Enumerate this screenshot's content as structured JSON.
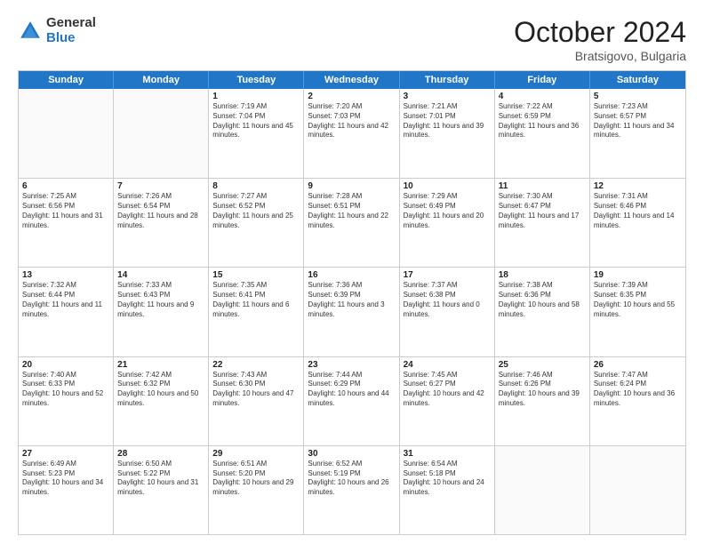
{
  "header": {
    "logo": {
      "general": "General",
      "blue": "Blue"
    },
    "month": "October 2024",
    "location": "Bratsigovo, Bulgaria"
  },
  "weekdays": [
    "Sunday",
    "Monday",
    "Tuesday",
    "Wednesday",
    "Thursday",
    "Friday",
    "Saturday"
  ],
  "rows": [
    [
      {
        "day": "",
        "info": ""
      },
      {
        "day": "",
        "info": ""
      },
      {
        "day": "1",
        "info": "Sunrise: 7:19 AM\nSunset: 7:04 PM\nDaylight: 11 hours and 45 minutes."
      },
      {
        "day": "2",
        "info": "Sunrise: 7:20 AM\nSunset: 7:03 PM\nDaylight: 11 hours and 42 minutes."
      },
      {
        "day": "3",
        "info": "Sunrise: 7:21 AM\nSunset: 7:01 PM\nDaylight: 11 hours and 39 minutes."
      },
      {
        "day": "4",
        "info": "Sunrise: 7:22 AM\nSunset: 6:59 PM\nDaylight: 11 hours and 36 minutes."
      },
      {
        "day": "5",
        "info": "Sunrise: 7:23 AM\nSunset: 6:57 PM\nDaylight: 11 hours and 34 minutes."
      }
    ],
    [
      {
        "day": "6",
        "info": "Sunrise: 7:25 AM\nSunset: 6:56 PM\nDaylight: 11 hours and 31 minutes."
      },
      {
        "day": "7",
        "info": "Sunrise: 7:26 AM\nSunset: 6:54 PM\nDaylight: 11 hours and 28 minutes."
      },
      {
        "day": "8",
        "info": "Sunrise: 7:27 AM\nSunset: 6:52 PM\nDaylight: 11 hours and 25 minutes."
      },
      {
        "day": "9",
        "info": "Sunrise: 7:28 AM\nSunset: 6:51 PM\nDaylight: 11 hours and 22 minutes."
      },
      {
        "day": "10",
        "info": "Sunrise: 7:29 AM\nSunset: 6:49 PM\nDaylight: 11 hours and 20 minutes."
      },
      {
        "day": "11",
        "info": "Sunrise: 7:30 AM\nSunset: 6:47 PM\nDaylight: 11 hours and 17 minutes."
      },
      {
        "day": "12",
        "info": "Sunrise: 7:31 AM\nSunset: 6:46 PM\nDaylight: 11 hours and 14 minutes."
      }
    ],
    [
      {
        "day": "13",
        "info": "Sunrise: 7:32 AM\nSunset: 6:44 PM\nDaylight: 11 hours and 11 minutes."
      },
      {
        "day": "14",
        "info": "Sunrise: 7:33 AM\nSunset: 6:43 PM\nDaylight: 11 hours and 9 minutes."
      },
      {
        "day": "15",
        "info": "Sunrise: 7:35 AM\nSunset: 6:41 PM\nDaylight: 11 hours and 6 minutes."
      },
      {
        "day": "16",
        "info": "Sunrise: 7:36 AM\nSunset: 6:39 PM\nDaylight: 11 hours and 3 minutes."
      },
      {
        "day": "17",
        "info": "Sunrise: 7:37 AM\nSunset: 6:38 PM\nDaylight: 11 hours and 0 minutes."
      },
      {
        "day": "18",
        "info": "Sunrise: 7:38 AM\nSunset: 6:36 PM\nDaylight: 10 hours and 58 minutes."
      },
      {
        "day": "19",
        "info": "Sunrise: 7:39 AM\nSunset: 6:35 PM\nDaylight: 10 hours and 55 minutes."
      }
    ],
    [
      {
        "day": "20",
        "info": "Sunrise: 7:40 AM\nSunset: 6:33 PM\nDaylight: 10 hours and 52 minutes."
      },
      {
        "day": "21",
        "info": "Sunrise: 7:42 AM\nSunset: 6:32 PM\nDaylight: 10 hours and 50 minutes."
      },
      {
        "day": "22",
        "info": "Sunrise: 7:43 AM\nSunset: 6:30 PM\nDaylight: 10 hours and 47 minutes."
      },
      {
        "day": "23",
        "info": "Sunrise: 7:44 AM\nSunset: 6:29 PM\nDaylight: 10 hours and 44 minutes."
      },
      {
        "day": "24",
        "info": "Sunrise: 7:45 AM\nSunset: 6:27 PM\nDaylight: 10 hours and 42 minutes."
      },
      {
        "day": "25",
        "info": "Sunrise: 7:46 AM\nSunset: 6:26 PM\nDaylight: 10 hours and 39 minutes."
      },
      {
        "day": "26",
        "info": "Sunrise: 7:47 AM\nSunset: 6:24 PM\nDaylight: 10 hours and 36 minutes."
      }
    ],
    [
      {
        "day": "27",
        "info": "Sunrise: 6:49 AM\nSunset: 5:23 PM\nDaylight: 10 hours and 34 minutes."
      },
      {
        "day": "28",
        "info": "Sunrise: 6:50 AM\nSunset: 5:22 PM\nDaylight: 10 hours and 31 minutes."
      },
      {
        "day": "29",
        "info": "Sunrise: 6:51 AM\nSunset: 5:20 PM\nDaylight: 10 hours and 29 minutes."
      },
      {
        "day": "30",
        "info": "Sunrise: 6:52 AM\nSunset: 5:19 PM\nDaylight: 10 hours and 26 minutes."
      },
      {
        "day": "31",
        "info": "Sunrise: 6:54 AM\nSunset: 5:18 PM\nDaylight: 10 hours and 24 minutes."
      },
      {
        "day": "",
        "info": ""
      },
      {
        "day": "",
        "info": ""
      }
    ]
  ]
}
